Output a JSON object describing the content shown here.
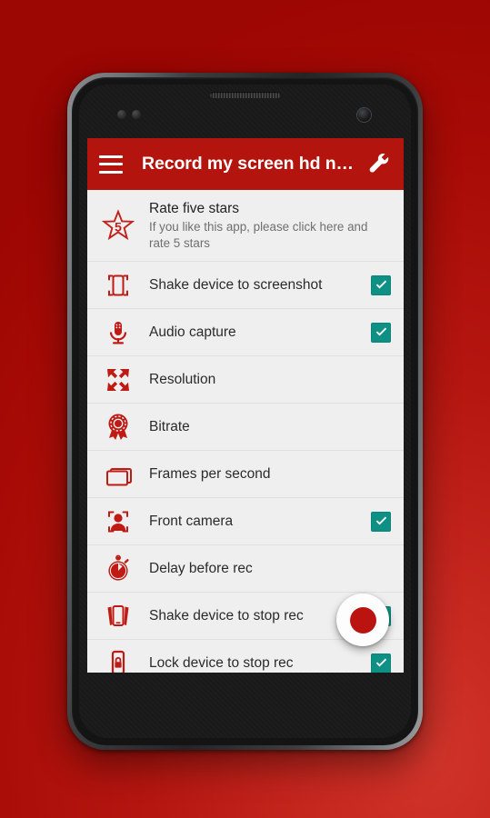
{
  "theme": {
    "backdrop_red": "#b51610",
    "appbar_red": "#b3140d",
    "icon_red": "#bf1b14",
    "checkbox_teal": "#0e9184",
    "list_bg": "#efefef",
    "divider": "#e0e0e0",
    "fab_white": "#fdfdfd",
    "fab_dot_red": "#bb1410"
  },
  "device": {
    "name": "android-phone-mockup",
    "earpiece": "earpiece-speaker",
    "camera": "front-camera-lens"
  },
  "appbar": {
    "menu_icon": "hamburger-menu-icon",
    "title": "Record my screen hd n…",
    "action_icon": "wrench-settings-icon"
  },
  "list": {
    "items": [
      {
        "id": "rate-five-stars",
        "icon": "star-five-icon",
        "title": "Rate five stars",
        "subtitle": "If you like this app, please click here and rate 5 stars",
        "has_checkbox": false,
        "checked": false
      },
      {
        "id": "shake-device-to-screenshot",
        "icon": "phone-shake-screenshot-icon",
        "title": "Shake device to screenshot",
        "subtitle": "",
        "has_checkbox": true,
        "checked": true
      },
      {
        "id": "audio-capture",
        "icon": "microphone-icon",
        "title": "Audio capture",
        "subtitle": "",
        "has_checkbox": true,
        "checked": true
      },
      {
        "id": "resolution",
        "icon": "expand-arrows-icon",
        "title": "Resolution",
        "subtitle": "",
        "has_checkbox": false,
        "checked": false
      },
      {
        "id": "bitrate",
        "icon": "award-ribbon-icon",
        "title": "Bitrate",
        "subtitle": "",
        "has_checkbox": false,
        "checked": false
      },
      {
        "id": "frames-per-second",
        "icon": "frames-stack-icon",
        "title": "Frames per second",
        "subtitle": "",
        "has_checkbox": false,
        "checked": false
      },
      {
        "id": "front-camera",
        "icon": "portrait-focus-icon",
        "title": "Front camera",
        "subtitle": "",
        "has_checkbox": true,
        "checked": true
      },
      {
        "id": "delay-before-rec",
        "icon": "stopwatch-icon",
        "title": "Delay before rec",
        "subtitle": "",
        "has_checkbox": false,
        "checked": false
      },
      {
        "id": "shake-device-to-stop-rec",
        "icon": "phone-shake-stop-icon",
        "title": "Shake device to stop rec",
        "subtitle": "",
        "has_checkbox": true,
        "checked": true
      },
      {
        "id": "lock-device-to-stop-rec",
        "icon": "phone-lock-icon",
        "title": "Lock device to stop rec",
        "subtitle": "",
        "has_checkbox": true,
        "checked": true
      }
    ]
  },
  "fab": {
    "name": "record-button",
    "icon": "record-dot-icon"
  }
}
